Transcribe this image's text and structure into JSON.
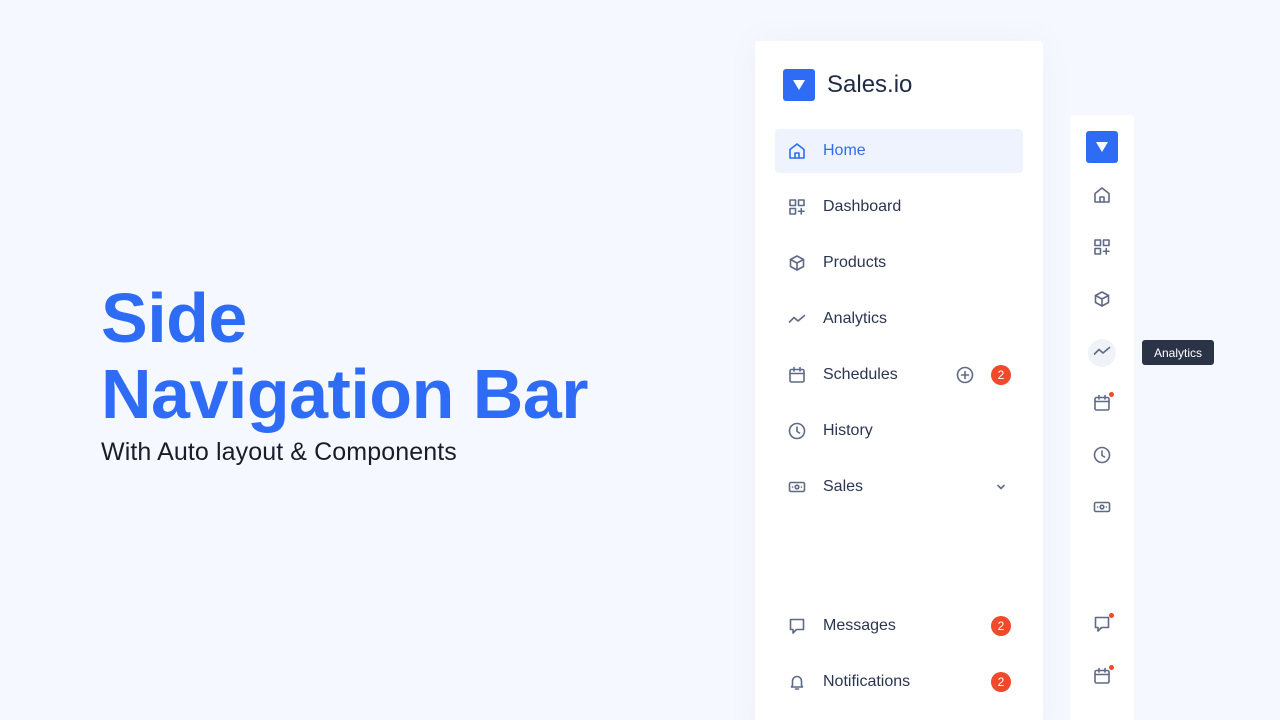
{
  "hero": {
    "title_line1": "Side",
    "title_line2": "Navigation Bar",
    "subtitle": "With Auto layout & Components"
  },
  "brand": {
    "name": "Sales.io"
  },
  "nav": {
    "items": [
      {
        "label": "Home",
        "icon": "home-icon",
        "active": true
      },
      {
        "label": "Dashboard",
        "icon": "dashboard-icon"
      },
      {
        "label": "Products",
        "icon": "box-icon"
      },
      {
        "label": "Analytics",
        "icon": "trend-icon"
      },
      {
        "label": "Schedules",
        "icon": "calendar-icon",
        "badge": "2"
      },
      {
        "label": "History",
        "icon": "clock-icon"
      },
      {
        "label": "Sales",
        "icon": "money-icon"
      }
    ],
    "bottom": [
      {
        "label": "Messages",
        "icon": "message-icon",
        "badge": "2"
      },
      {
        "label": "Notifications",
        "icon": "bell-icon",
        "badge": "2"
      }
    ]
  },
  "tooltip": {
    "text": "Analytics"
  },
  "colors": {
    "accent": "#2f6cf6",
    "badge": "#f0492c",
    "background": "#f5f8fe",
    "tooltip": "#2b3447"
  }
}
